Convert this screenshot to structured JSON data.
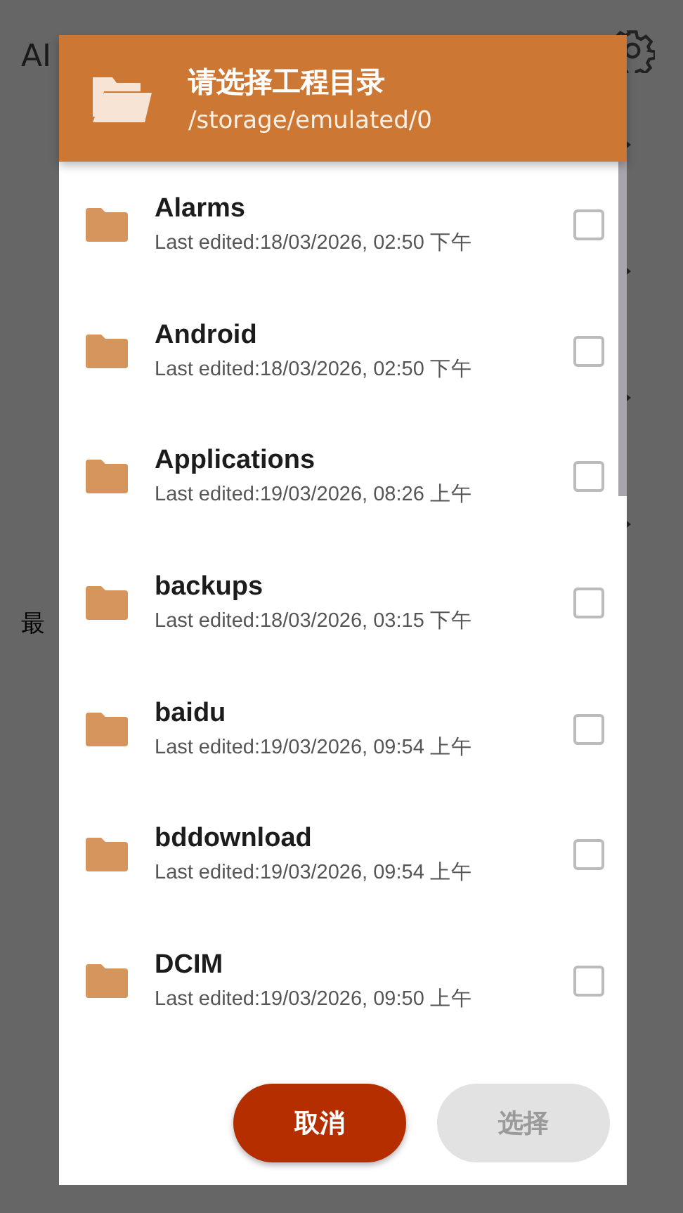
{
  "background": {
    "title": "AI",
    "rows": [
      {
        "kind": "chevron"
      },
      {
        "kind": "chevron"
      },
      {
        "kind": "chevron"
      },
      {
        "kind": "chevron"
      }
    ],
    "recent_label": "最"
  },
  "dialog": {
    "title": "请选择工程目录",
    "path": "/storage/emulated/0",
    "items": [
      {
        "name": "Alarms",
        "edited": "Last edited:18/03/2026, 02:50 下午",
        "checked": false
      },
      {
        "name": "Android",
        "edited": "Last edited:18/03/2026, 02:50 下午",
        "checked": false
      },
      {
        "name": "Applications",
        "edited": "Last edited:19/03/2026, 08:26 上午",
        "checked": false
      },
      {
        "name": "backups",
        "edited": "Last edited:18/03/2026, 03:15 下午",
        "checked": false
      },
      {
        "name": "baidu",
        "edited": "Last edited:19/03/2026, 09:54 上午",
        "checked": false
      },
      {
        "name": "bddownload",
        "edited": "Last edited:19/03/2026, 09:54 上午",
        "checked": false
      },
      {
        "name": "DCIM",
        "edited": "Last edited:19/03/2026, 09:50 上午",
        "checked": false
      }
    ],
    "buttons": [
      {
        "label": "取消",
        "disabled": false
      },
      {
        "label": "选择",
        "disabled": true
      }
    ]
  }
}
